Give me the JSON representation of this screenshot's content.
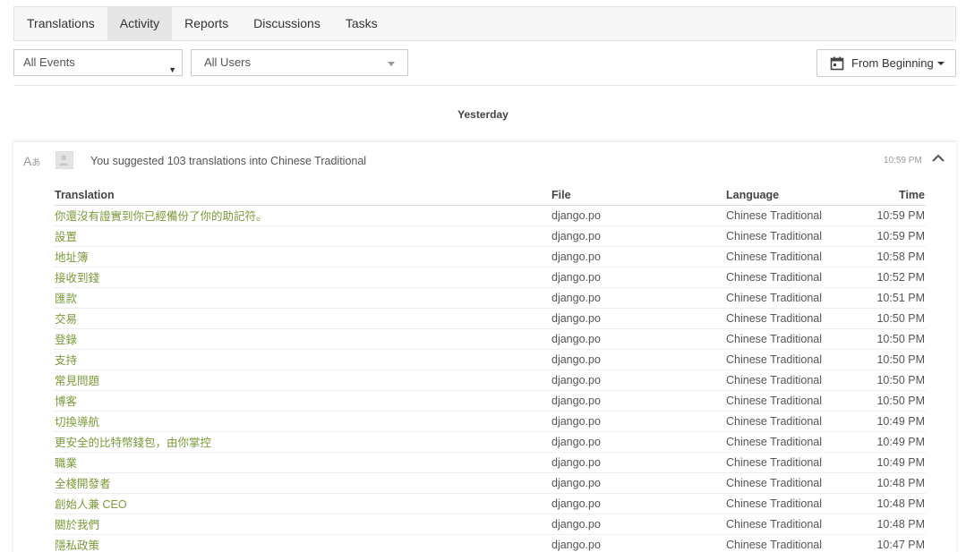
{
  "tabs": [
    {
      "label": "Translations",
      "active": false
    },
    {
      "label": "Activity",
      "active": true
    },
    {
      "label": "Reports",
      "active": false
    },
    {
      "label": "Discussions",
      "active": false
    },
    {
      "label": "Tasks",
      "active": false
    }
  ],
  "filters": {
    "events": "All Events",
    "users": "All Users",
    "date_range": "From Beginning"
  },
  "day_heading": "Yesterday",
  "activity": {
    "summary": "You suggested 103 translations into Chinese Traditional",
    "timestamp": "10:59 PM",
    "columns": [
      "Translation",
      "File",
      "Language",
      "Time"
    ],
    "rows": [
      {
        "translation": "你還沒有證實到你已經備份了你的助記符。",
        "file": "django.po",
        "language": "Chinese Traditional",
        "time": "10:59 PM"
      },
      {
        "translation": "設置",
        "file": "django.po",
        "language": "Chinese Traditional",
        "time": "10:59 PM"
      },
      {
        "translation": "地址簿",
        "file": "django.po",
        "language": "Chinese Traditional",
        "time": "10:58 PM"
      },
      {
        "translation": "接收到錢",
        "file": "django.po",
        "language": "Chinese Traditional",
        "time": "10:52 PM"
      },
      {
        "translation": "匯款",
        "file": "django.po",
        "language": "Chinese Traditional",
        "time": "10:51 PM"
      },
      {
        "translation": "交易",
        "file": "django.po",
        "language": "Chinese Traditional",
        "time": "10:50 PM"
      },
      {
        "translation": "登錄",
        "file": "django.po",
        "language": "Chinese Traditional",
        "time": "10:50 PM"
      },
      {
        "translation": "支持",
        "file": "django.po",
        "language": "Chinese Traditional",
        "time": "10:50 PM"
      },
      {
        "translation": "常見問題",
        "file": "django.po",
        "language": "Chinese Traditional",
        "time": "10:50 PM"
      },
      {
        "translation": "博客",
        "file": "django.po",
        "language": "Chinese Traditional",
        "time": "10:50 PM"
      },
      {
        "translation": "切換導航",
        "file": "django.po",
        "language": "Chinese Traditional",
        "time": "10:49 PM"
      },
      {
        "translation": "更安全的比特幣錢包，由你掌控",
        "file": "django.po",
        "language": "Chinese Traditional",
        "time": "10:49 PM"
      },
      {
        "translation": "職業",
        "file": "django.po",
        "language": "Chinese Traditional",
        "time": "10:49 PM"
      },
      {
        "translation": "全棧開發者",
        "file": "django.po",
        "language": "Chinese Traditional",
        "time": "10:48 PM"
      },
      {
        "translation": "創始人兼 CEO",
        "file": "django.po",
        "language": "Chinese Traditional",
        "time": "10:48 PM"
      },
      {
        "translation": "關於我們",
        "file": "django.po",
        "language": "Chinese Traditional",
        "time": "10:48 PM"
      },
      {
        "translation": "隱私政策",
        "file": "django.po",
        "language": "Chinese Traditional",
        "time": "10:47 PM"
      }
    ]
  },
  "colors": {
    "translation_text": "#7a9a3a",
    "active_tab_bg": "#e6e6e6"
  },
  "icons": {
    "activity": "translate-icon",
    "date": "calendar-icon",
    "collapse": "chevron-up-icon"
  }
}
